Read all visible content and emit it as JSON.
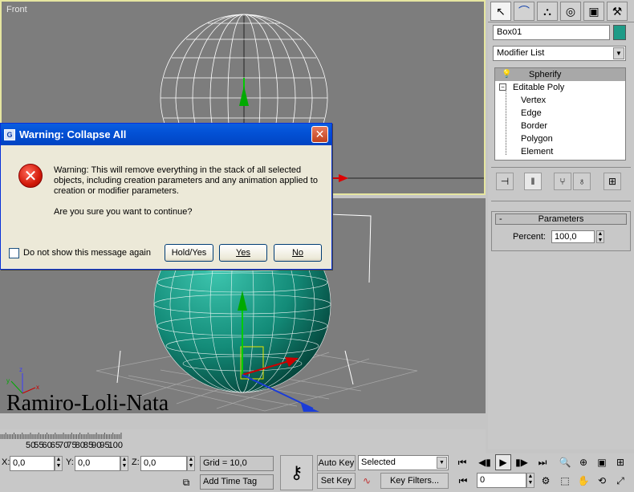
{
  "viewports": {
    "front_label": "Front",
    "watermark": "Ramiro-Loli-Nata"
  },
  "command_panel": {
    "object_name": "Box01",
    "object_color": "#1e9b87",
    "modifier_list": "Modifier List",
    "stack": [
      {
        "label": "Spherify",
        "selected": true
      },
      {
        "label": "Editable Poly"
      },
      {
        "label": "Vertex"
      },
      {
        "label": "Edge"
      },
      {
        "label": "Border"
      },
      {
        "label": "Polygon"
      },
      {
        "label": "Element"
      }
    ],
    "parameters": {
      "title": "Parameters",
      "collapse": "-",
      "percent_label": "Percent:",
      "percent_value": "100,0"
    }
  },
  "dialog": {
    "title": "Warning: Collapse All",
    "message": "Warning: This will remove everything in the stack of all selected objects, including creation parameters and any animation applied to creation or modifier parameters.",
    "question": "Are you sure you want to continue?",
    "checkbox_label": "Do not show this message again",
    "buttons": {
      "hold_yes": "Hold/Yes",
      "yes": "Yes",
      "no": "No"
    }
  },
  "timeline": {
    "ticks": [
      "50",
      "55",
      "60",
      "65",
      "70",
      "75",
      "80",
      "85",
      "90",
      "95",
      "100"
    ]
  },
  "status_bar": {
    "x_label": "X:",
    "x_value": "0,0",
    "y_label": "Y:",
    "y_value": "0,0",
    "z_label": "Z:",
    "z_value": "0,0",
    "grid": "Grid = 10,0",
    "add_time_tag": "Add Time Tag",
    "auto_key": "Auto Key",
    "set_key": "Set Key",
    "selected": "Selected",
    "key_filters": "Key Filters...",
    "frame": "0"
  }
}
